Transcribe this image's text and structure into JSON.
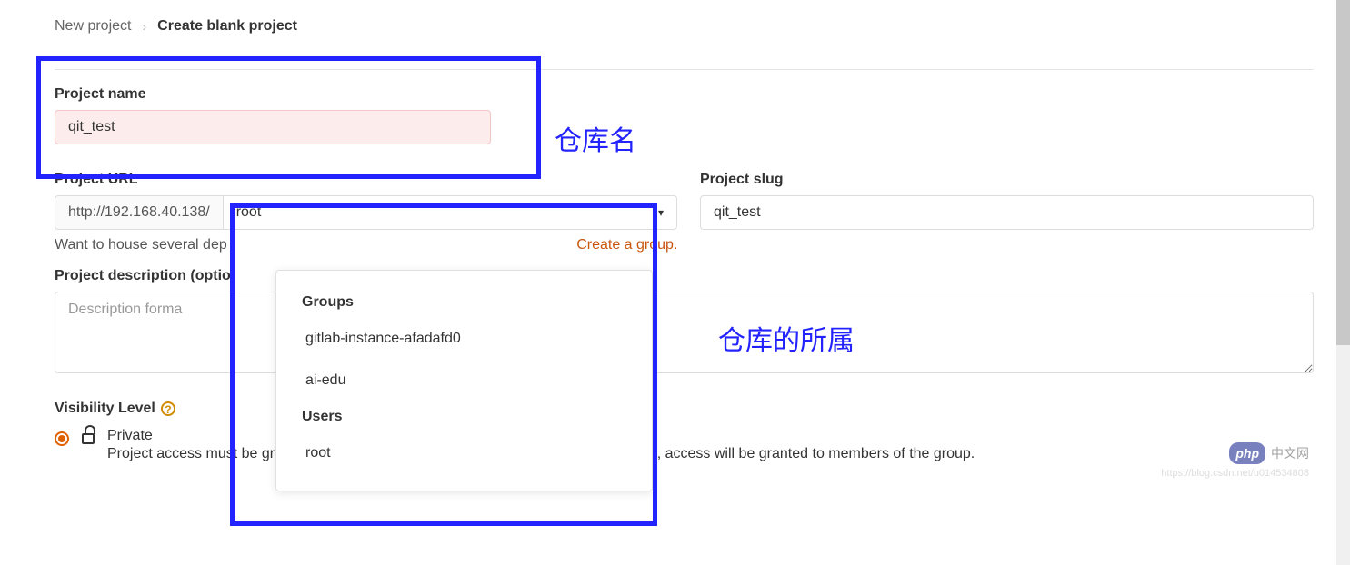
{
  "breadcrumb": {
    "parent": "New project",
    "current": "Create blank project"
  },
  "project_name": {
    "label": "Project name",
    "value": "qit_test"
  },
  "annotations": {
    "repo_name": "仓库名",
    "repo_owner": "仓库的所属"
  },
  "project_url": {
    "label": "Project URL",
    "prefix": "http://192.168.40.138/",
    "selected": "root"
  },
  "project_slug": {
    "label": "Project slug",
    "value": "qit_test"
  },
  "dropdown": {
    "groups_header": "Groups",
    "users_header": "Users",
    "items_groups": [
      "gitlab-instance-afadafd0",
      "ai-edu"
    ],
    "items_users": [
      "root"
    ]
  },
  "helper": {
    "text": "Want to house several dep",
    "link": "Create a group."
  },
  "description": {
    "label": "Project description (optio",
    "placeholder": "Description forma"
  },
  "visibility": {
    "label": "Visibility Level",
    "option_title": "Private",
    "option_desc": "Project access must be granted explicitly to each user. If this project is part of a group, access will be granted to members of the group."
  },
  "watermark": {
    "badge": "php",
    "text": "中文网",
    "url": "https://blog.csdn.net/u014534808"
  }
}
